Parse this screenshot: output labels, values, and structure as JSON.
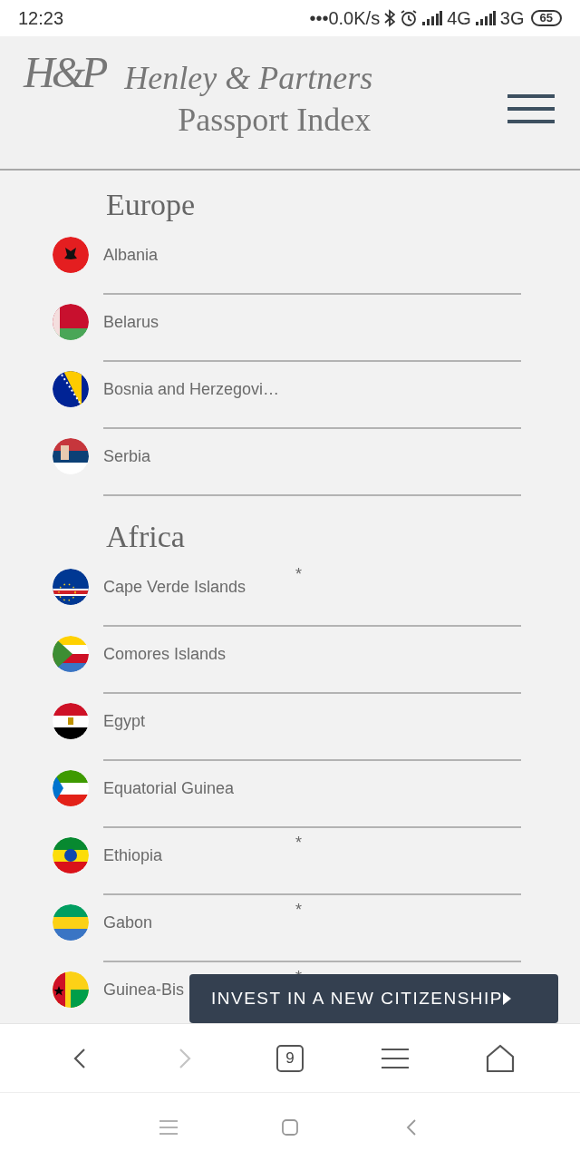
{
  "status_bar": {
    "time": "12:23",
    "network_speed": "•••0.0K/s",
    "network_1": "4G",
    "network_2": "3G",
    "battery": "65"
  },
  "header": {
    "logo": "H&P",
    "brand": "Henley & Partners",
    "subtitle": "Passport Index"
  },
  "sections": [
    {
      "title": "Europe",
      "countries": [
        {
          "name": "Albania"
        },
        {
          "name": "Belarus"
        },
        {
          "name": "Bosnia and Herzegovi…"
        },
        {
          "name": "Serbia"
        }
      ]
    },
    {
      "title": "Africa",
      "countries": [
        {
          "name": "Cape Verde Islands",
          "note": "*"
        },
        {
          "name": "Comores Islands"
        },
        {
          "name": "Egypt"
        },
        {
          "name": "Equatorial Guinea"
        },
        {
          "name": "Ethiopia",
          "note": "*"
        },
        {
          "name": "Gabon",
          "note": "*"
        },
        {
          "name": "Guinea-Bis",
          "note": "*"
        }
      ]
    }
  ],
  "cta_button": {
    "label": "INVEST IN A NEW CITIZENSHIP"
  },
  "browser_toolbar": {
    "tab_count": "9",
    "buttons": [
      {
        "kind": "back",
        "disabled": false
      },
      {
        "kind": "forward",
        "disabled": true
      },
      {
        "kind": "tabs",
        "disabled": false
      },
      {
        "kind": "menu",
        "disabled": false
      },
      {
        "kind": "home",
        "disabled": false
      }
    ]
  },
  "system_nav": {
    "buttons": [
      {
        "kind": "menu"
      },
      {
        "kind": "home"
      },
      {
        "kind": "back"
      }
    ]
  }
}
